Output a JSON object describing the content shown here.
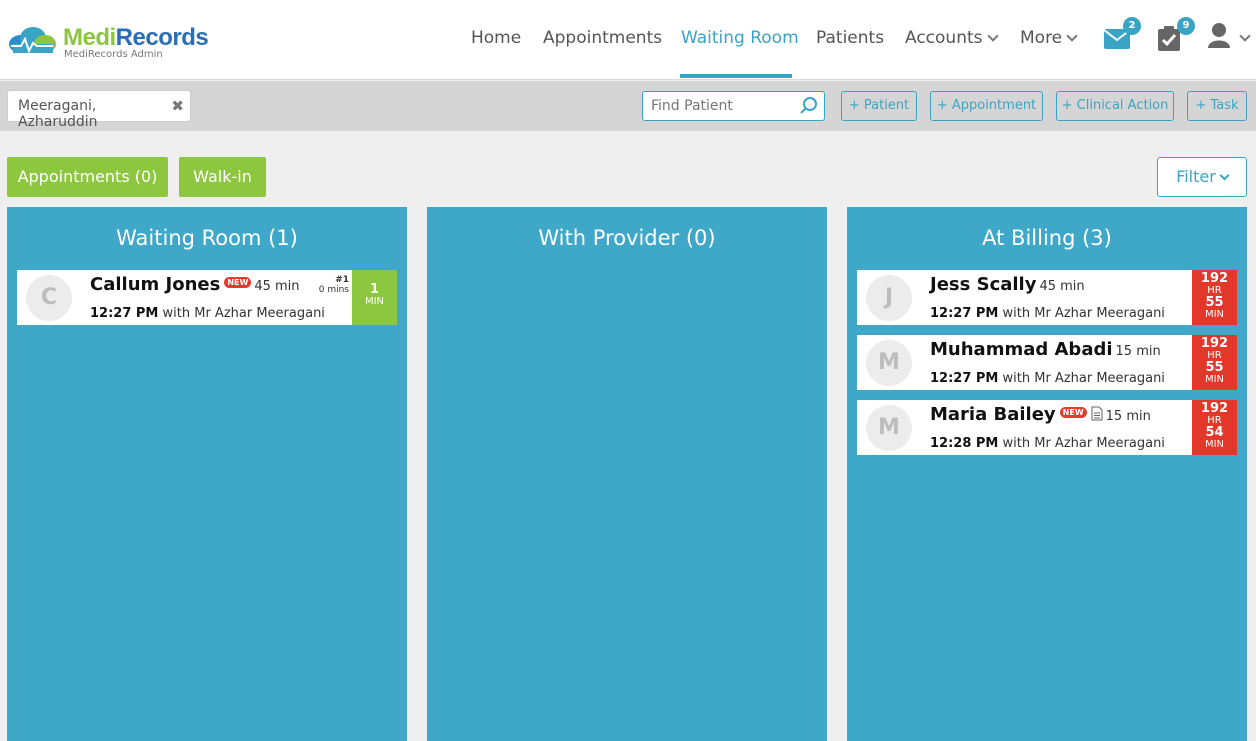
{
  "brand": {
    "name_part1": "Medi",
    "name_part2": "Records",
    "subtitle": "MediRecords Admin"
  },
  "nav": {
    "items": [
      {
        "label": "Home",
        "active": false
      },
      {
        "label": "Appointments",
        "active": false
      },
      {
        "label": "Waiting Room",
        "active": true
      },
      {
        "label": "Patients",
        "active": false
      },
      {
        "label": "Accounts",
        "active": false,
        "dropdown": true
      },
      {
        "label": "More",
        "active": false,
        "dropdown": true
      }
    ],
    "messages_count": "2",
    "tasks_count": "9"
  },
  "toolbar": {
    "patient_chip": "Meeragani, Azharuddin",
    "find_placeholder": "Find Patient",
    "buttons": [
      "+ Patient",
      "+ Appointment",
      "+ Clinical Action",
      "+ Task"
    ]
  },
  "actions": {
    "appointments": "Appointments (0)",
    "walkin": "Walk-in",
    "filter": "Filter"
  },
  "columns": [
    {
      "title": "Waiting Room (1)",
      "cards": [
        {
          "initial": "C",
          "name": "Callum Jones",
          "new": true,
          "doc": false,
          "duration": "45 min",
          "time": "12:27 PM",
          "with": "with Mr Azhar Meeragani",
          "queue_pos": "#1",
          "queue_wait": "0 mins",
          "timer_top": "1",
          "timer_bottom": "MIN",
          "timer_color": "green"
        }
      ]
    },
    {
      "title": "With Provider (0)",
      "cards": []
    },
    {
      "title": "At Billing (3)",
      "cards": [
        {
          "initial": "J",
          "name": "Jess Scally",
          "new": false,
          "doc": false,
          "duration": "45 min",
          "time": "12:27 PM",
          "with": "with Mr Azhar Meeragani",
          "hr_val": "192",
          "hr": "HR",
          "min_val": "55",
          "min": "MIN",
          "timer_color": "red"
        },
        {
          "initial": "M",
          "name": "Muhammad Abadi",
          "new": false,
          "doc": false,
          "duration": "15 min",
          "time": "12:27 PM",
          "with": "with Mr Azhar Meeragani",
          "hr_val": "192",
          "hr": "HR",
          "min_val": "55",
          "min": "MIN",
          "timer_color": "red"
        },
        {
          "initial": "M",
          "name": "Maria Bailey",
          "new": true,
          "doc": true,
          "duration": "15 min",
          "time": "12:28 PM",
          "with": "with Mr Azhar Meeragani",
          "hr_val": "192",
          "hr": "HR",
          "min_val": "54",
          "min": "MIN",
          "timer_color": "red"
        }
      ]
    }
  ],
  "new_badge_label": "NEW",
  "colors": {
    "accent": "#3aa4c5",
    "green": "#8dc63f",
    "column_bg": "#3fa8c8",
    "alert_red": "#e3372a"
  }
}
